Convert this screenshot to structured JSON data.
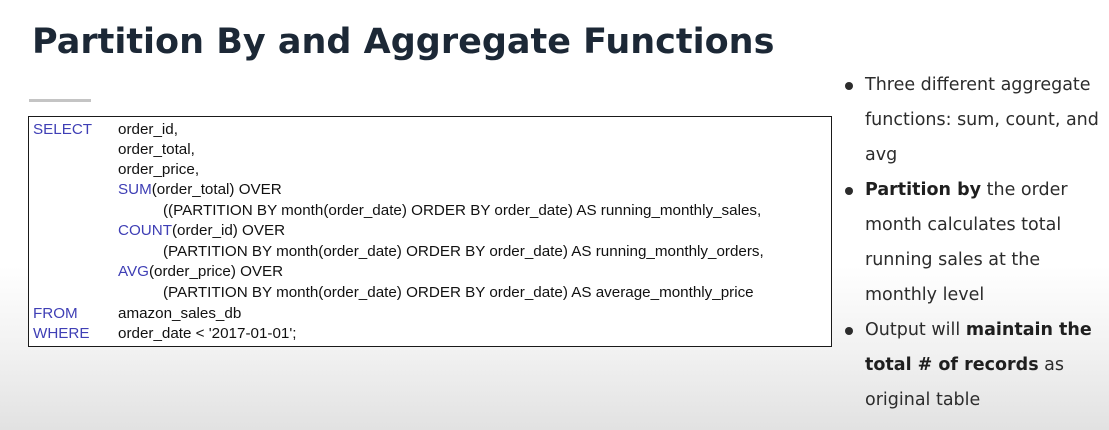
{
  "slide": {
    "title": "Partition By and Aggregate Functions"
  },
  "code": {
    "lines": [
      {
        "keyword": "SELECT",
        "text": "order_id,"
      },
      {
        "text": "order_total,"
      },
      {
        "text": "order_price,"
      },
      {
        "fn": "SUM",
        "text": "(order_total) OVER"
      },
      {
        "text": "((PARTITION BY month(order_date) ORDER BY order_date) AS running_monthly_sales,"
      },
      {
        "fn": "COUNT",
        "text": "(order_id) OVER"
      },
      {
        "text": "(PARTITION BY month(order_date) ORDER BY order_date) AS running_monthly_orders,"
      },
      {
        "fn": "AVG",
        "text": "(order_price) OVER"
      },
      {
        "text": "(PARTITION BY month(order_date) ORDER BY order_date) AS average_monthly_price"
      },
      {
        "keyword": "FROM",
        "text": "amazon_sales_db"
      },
      {
        "keyword": "WHERE",
        "text": "order_date < '2017-01-01';"
      }
    ]
  },
  "bullets": [
    {
      "parts": [
        {
          "t": "Three different aggregate functions: sum, count, and avg",
          "b": false
        }
      ]
    },
    {
      "parts": [
        {
          "t": "Partition by",
          "b": true
        },
        {
          "t": " the order month calculates total running sales at the monthly level",
          "b": false
        }
      ]
    },
    {
      "parts": [
        {
          "t": "Output will ",
          "b": false
        },
        {
          "t": "maintain the total # of records",
          "b": true
        },
        {
          "t": " as original table",
          "b": false
        }
      ]
    }
  ],
  "colors": {
    "title": "#1c2836",
    "sql_keyword": "#3f3fb5",
    "code_text": "#111111",
    "bullet_text": "#2c2c2c"
  }
}
